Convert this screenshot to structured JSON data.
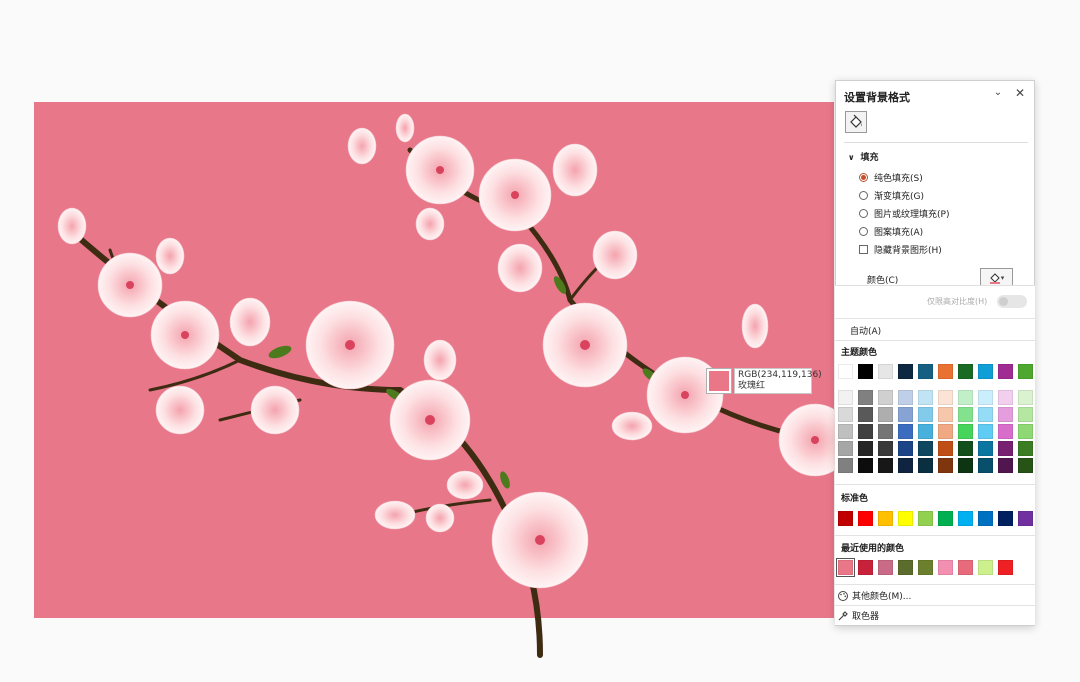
{
  "tooltip": {
    "rgb": "RGB(234,119,136)",
    "name": "玫瑰红"
  },
  "pane": {
    "title": "设置背景格式",
    "section": "填充",
    "options": [
      {
        "label": "纯色填充(S)",
        "selected": true
      },
      {
        "label": "渐变填充(G)",
        "selected": false
      },
      {
        "label": "图片或纹理填充(P)",
        "selected": false
      },
      {
        "label": "图案填充(A)",
        "selected": false
      }
    ],
    "hide_graphics": "隐藏背景图形(H)",
    "color_label": "颜色(C)"
  },
  "colors": {
    "contrast_only": "仅限高对比度(H)",
    "auto": "自动(A)",
    "theme_title": "主题颜色",
    "theme_top": [
      "#ffffff",
      "#000000",
      "#e7e6e6",
      "#0e2841",
      "#156082",
      "#e97132",
      "#196b24",
      "#0f9ed5",
      "#a02b93",
      "#4ea72e"
    ],
    "theme_shades": [
      [
        "#f2f2f2",
        "#808080",
        "#d0d0d0",
        "#c0cfe8",
        "#c1e4f5",
        "#fbe3d6",
        "#c1f0c8",
        "#caeefb",
        "#f2cfee",
        "#daf2d0"
      ],
      [
        "#d9d9d9",
        "#595959",
        "#aeaeae",
        "#86a3d4",
        "#83cbeb",
        "#f7c7ac",
        "#83e28e",
        "#95dcf7",
        "#e59edd",
        "#b5e6a2"
      ],
      [
        "#bfbfbf",
        "#404040",
        "#757575",
        "#3b6cc0",
        "#47b0dc",
        "#f1a983",
        "#47d45a",
        "#60cbf3",
        "#d86dcb",
        "#8ed973"
      ],
      [
        "#a6a6a6",
        "#262626",
        "#3a3a3a",
        "#1b4587",
        "#0f4761",
        "#c04f15",
        "#124f1a",
        "#0b769f",
        "#782170",
        "#3b7d23"
      ],
      [
        "#808080",
        "#0d0d0d",
        "#171717",
        "#0f2440",
        "#0a2f40",
        "#7f350e",
        "#0d3512",
        "#074f6a",
        "#511650",
        "#275317"
      ]
    ],
    "standard_title": "标准色",
    "standard": [
      "#c00000",
      "#ff0000",
      "#ffc000",
      "#ffff00",
      "#92d050",
      "#00b050",
      "#00b0f0",
      "#0070c0",
      "#002060",
      "#7030a0"
    ],
    "recent_title": "最近使用的颜色",
    "recent": [
      "#ea7788",
      "#c8213a",
      "#c96a86",
      "#5b6c2c",
      "#6b7f2c",
      "#f38fb0",
      "#e86b7c",
      "#ccf08c",
      "#ee2024"
    ],
    "more": "其他颜色(M)...",
    "picker": "取色器"
  }
}
